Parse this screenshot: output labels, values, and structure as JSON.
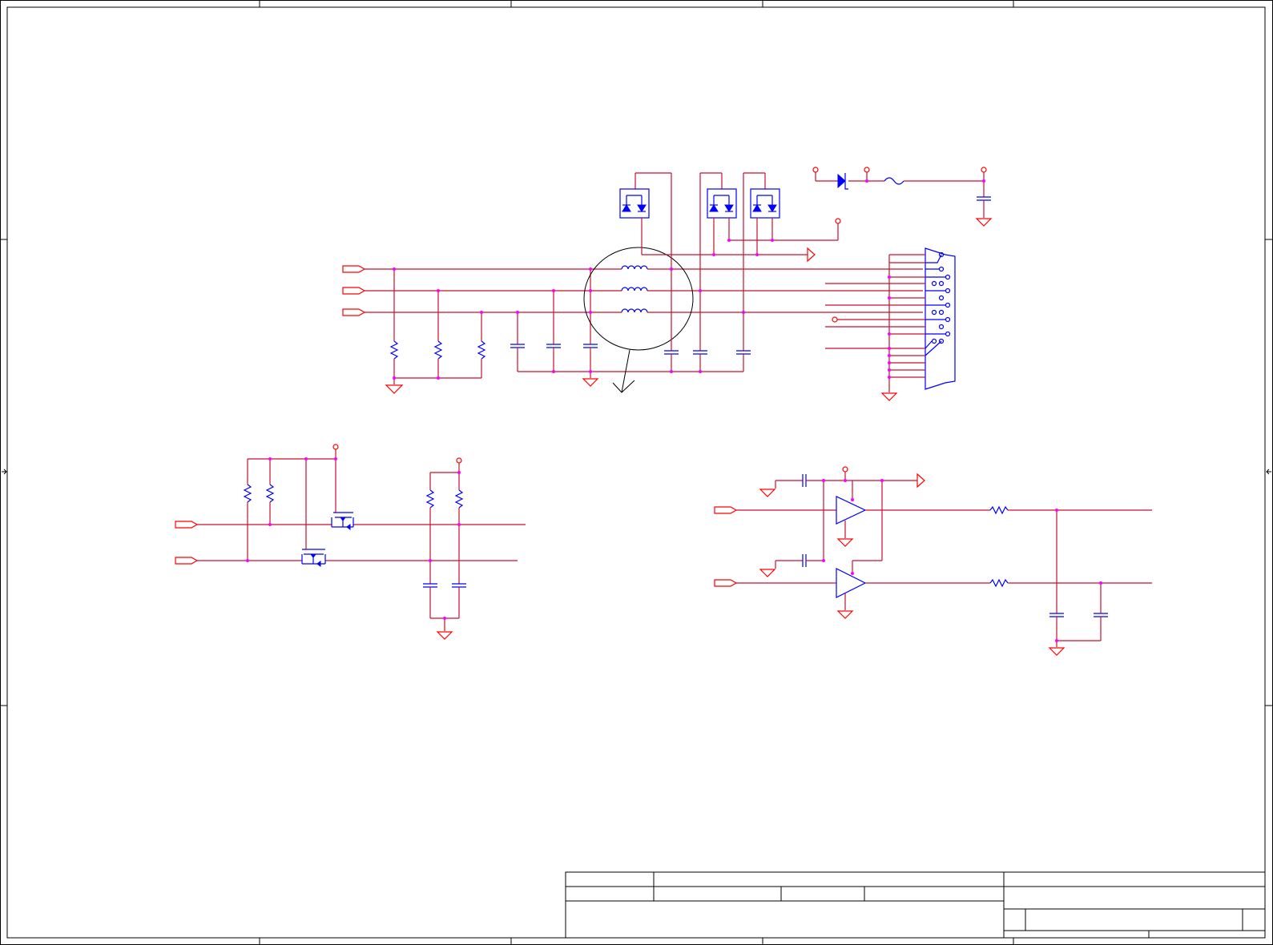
{
  "sheet": {
    "title_block": {
      "title": "",
      "size": "",
      "number": "",
      "revision": "",
      "date": "",
      "sheet_of": "",
      "drawn_by": "",
      "file": ""
    }
  },
  "colors": {
    "wire": "#c8102e",
    "component": "#0000ff",
    "junction": "#ff00ff",
    "power_ground": "#ff0000",
    "frame": "#000000"
  },
  "icons": {
    "ground": "ground-icon",
    "power": "power-port-icon",
    "input_port": "input-port-icon",
    "resistor": "resistor-icon",
    "capacitor": "capacitor-icon",
    "inductor": "inductor-icon",
    "diode": "diode-icon",
    "mosfet": "mosfet-icon",
    "buffer": "buffer-amplifier-icon",
    "connector": "db15-connector-icon",
    "fuse": "fuse-icon"
  }
}
